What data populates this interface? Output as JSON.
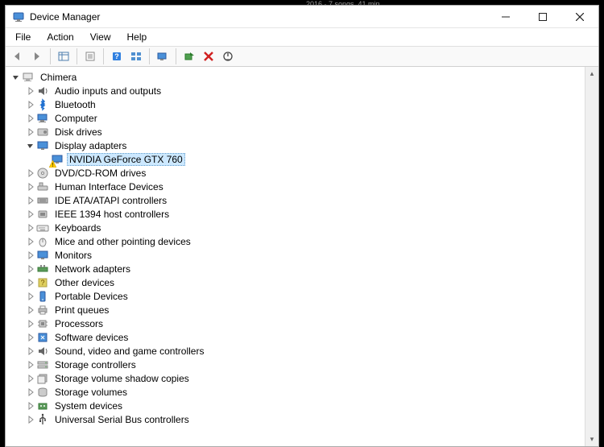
{
  "bg_text": "2016 · 7 songs, 41 min",
  "title": "Device Manager",
  "menus": {
    "file": "File",
    "action": "Action",
    "view": "View",
    "help": "Help"
  },
  "root": "Chimera",
  "nodes": [
    {
      "label": "Audio inputs and outputs",
      "icon": "audio"
    },
    {
      "label": "Bluetooth",
      "icon": "bluetooth"
    },
    {
      "label": "Computer",
      "icon": "computer"
    },
    {
      "label": "Disk drives",
      "icon": "disk"
    },
    {
      "label": "Display adapters",
      "icon": "display",
      "expanded": true,
      "children": [
        {
          "label": "NVIDIA GeForce GTX 760",
          "icon": "display",
          "warn": true,
          "selected": true
        }
      ]
    },
    {
      "label": "DVD/CD-ROM drives",
      "icon": "dvd"
    },
    {
      "label": "Human Interface Devices",
      "icon": "hid"
    },
    {
      "label": "IDE ATA/ATAPI controllers",
      "icon": "ide"
    },
    {
      "label": "IEEE 1394 host controllers",
      "icon": "ieee"
    },
    {
      "label": "Keyboards",
      "icon": "keyboard"
    },
    {
      "label": "Mice and other pointing devices",
      "icon": "mouse"
    },
    {
      "label": "Monitors",
      "icon": "monitor"
    },
    {
      "label": "Network adapters",
      "icon": "network"
    },
    {
      "label": "Other devices",
      "icon": "other"
    },
    {
      "label": "Portable Devices",
      "icon": "portable"
    },
    {
      "label": "Print queues",
      "icon": "printer"
    },
    {
      "label": "Processors",
      "icon": "cpu"
    },
    {
      "label": "Software devices",
      "icon": "software"
    },
    {
      "label": "Sound, video and game controllers",
      "icon": "sound"
    },
    {
      "label": "Storage controllers",
      "icon": "storage"
    },
    {
      "label": "Storage volume shadow copies",
      "icon": "shadow"
    },
    {
      "label": "Storage volumes",
      "icon": "volume"
    },
    {
      "label": "System devices",
      "icon": "system"
    },
    {
      "label": "Universal Serial Bus controllers",
      "icon": "usb"
    }
  ]
}
